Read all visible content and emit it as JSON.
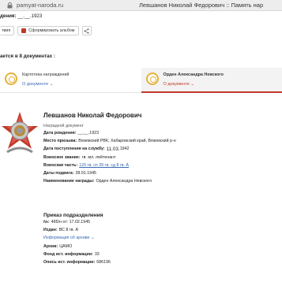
{
  "browser": {
    "url": "pamyat-naroda.ru",
    "tab_title": "Левшанов Николай Федорович :: Память нар"
  },
  "header": {
    "birth_label": "дения:",
    "birth_value": "__.__.1923",
    "btn_print": "твия",
    "btn_album": "Сформировать альбом"
  },
  "mentions_text": "ается в 8 документах :",
  "cards": [
    {
      "title": "Картотека награждений",
      "link": "О документе"
    },
    {
      "title": "Орден Александра Невского",
      "link": "О документе"
    }
  ],
  "record": {
    "name": "Левшанов Николай Федорович",
    "doc_type": "Наградной документ",
    "rows": [
      {
        "k": "Дата рождения:",
        "v": "__.__.1923"
      },
      {
        "k": "Место призыва:",
        "v": "Вяземский РВК, Хабаровский край, Вяземский р-н"
      },
      {
        "k": "Дата поступления на службу:",
        "v_stamp": "11.03.",
        "v": "1942"
      },
      {
        "k": "Воинское звание:",
        "v": "гв. мл. лейтенант"
      },
      {
        "k": "Воинская часть:",
        "v": "120 гв. сп 39 гв. сд 8 гв. А",
        "link": true
      },
      {
        "k": "Даты подвига:",
        "v": "28.01.1945"
      },
      {
        "k": "Наименование награды:",
        "v": "Орден Александра Невского"
      }
    ]
  },
  "order": {
    "title": "Приказ подразделения",
    "rows": [
      {
        "k": "№:",
        "v": "485/н от: 17.02.1945"
      },
      {
        "k": "Издан:",
        "v": "ВС 8 гв. А"
      }
    ],
    "archive_link": "Информация об архиве",
    "archive_rows": [
      {
        "k": "Архив:",
        "v": "ЦАМО"
      },
      {
        "k": "Фонд ист. информации:",
        "v": "33"
      },
      {
        "k": "Опись ист. информации:",
        "v": "686196"
      }
    ]
  }
}
